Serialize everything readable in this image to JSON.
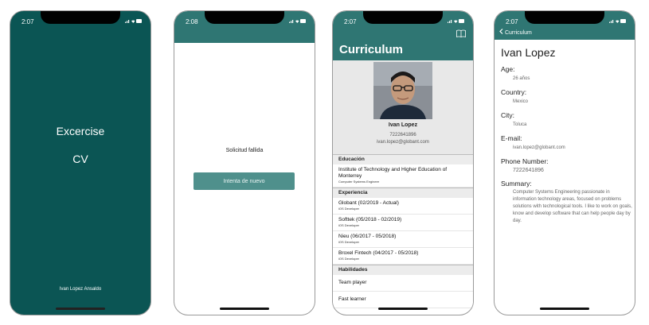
{
  "status": {
    "time1": "2:07",
    "time2": "2:08",
    "time3": "2:07",
    "time4": "2:07",
    "icons": "▂▄▆ ▬"
  },
  "splash": {
    "title": "Excercise",
    "subtitle": "CV",
    "author": "Ivan Lopez Ansaldo"
  },
  "error": {
    "message": "Solicitud fallida",
    "retry_label": "Intenta de nuevo"
  },
  "curriculum": {
    "title": "Curriculum",
    "name": "Ivan Lopez",
    "phone": "7222641896",
    "email": "ivan.lopez@globant.com",
    "sections": {
      "education": "Educación",
      "experience": "Experiencia",
      "skills": "Habilidades"
    },
    "education": [
      {
        "title": "Institute of Technology and Higher Education of Monterrey",
        "subtitle": "Computer Systems Engineer"
      }
    ],
    "experience": [
      {
        "title": "Globant (02/2019 - Actual)",
        "subtitle": "iOS Developer"
      },
      {
        "title": "Softtek (05/2018 - 02/2019)",
        "subtitle": "iOS Developer"
      },
      {
        "title": "Nieu (06/2017 - 05/2018)",
        "subtitle": "iOS Developer"
      },
      {
        "title": "Broxel Fintech (04/2017 - 05/2018)",
        "subtitle": "iOS Developer"
      }
    ],
    "skills": [
      "Team player",
      "Fast learner"
    ]
  },
  "detail": {
    "back_label": "Curriculum",
    "name": "Ivan Lopez",
    "age_label": "Age:",
    "age": "26 años",
    "country_label": "Country:",
    "country": "Mexico",
    "city_label": "City:",
    "city": "Toluca",
    "email_label": "E-mail:",
    "email": "ivan.lopez@globant.com",
    "phone_label": "Phone Number:",
    "phone": "7222641896",
    "summary_label": "Summary:",
    "summary": "Computer Systems Engineering passionate in information technology areas, focused on problems solutions with technological tools. I like to work on goals, know and develop software that can help people day by day."
  },
  "colors": {
    "brand": "#2f7673",
    "splash_bg": "#0b5554",
    "button": "#4f908c"
  }
}
